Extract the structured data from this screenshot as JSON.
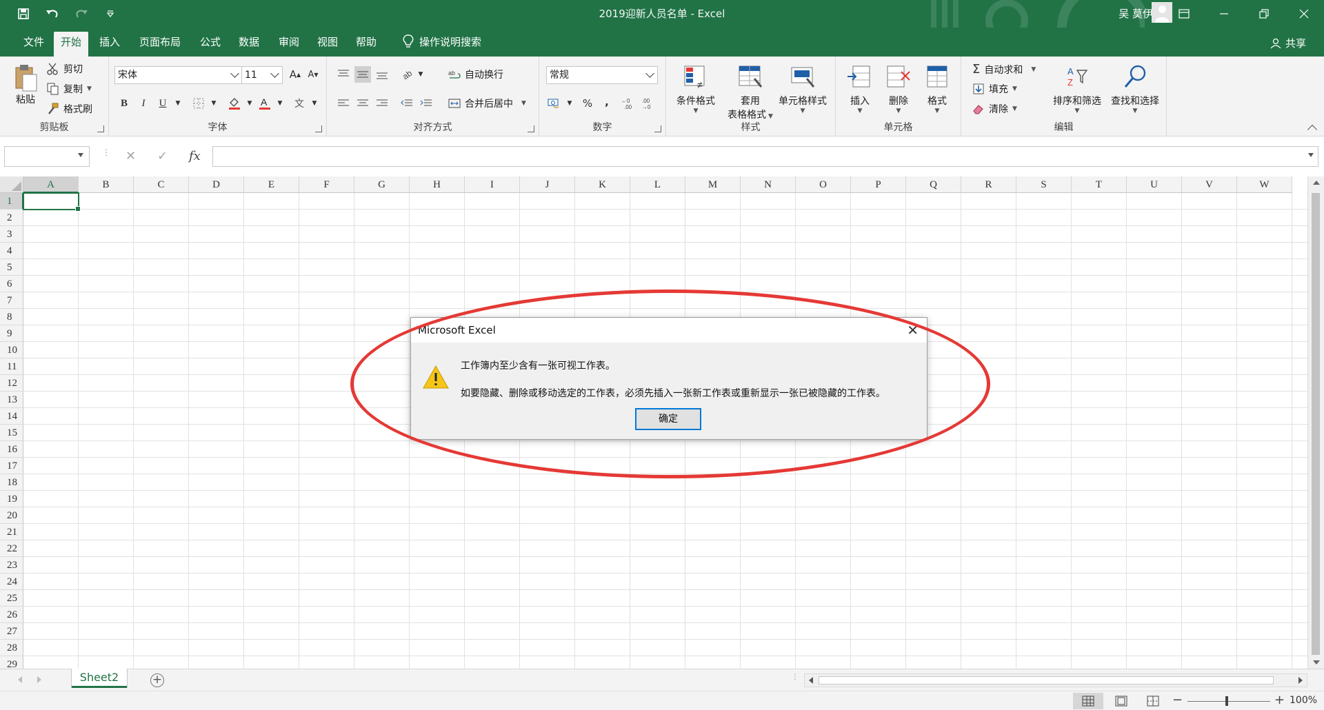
{
  "window": {
    "title": "2019迎新人员名单  -  Excel",
    "user": "吴 莫伊",
    "brand_color": "#217346"
  },
  "menu": {
    "tabs": [
      "文件",
      "开始",
      "插入",
      "页面布局",
      "公式",
      "数据",
      "审阅",
      "视图",
      "帮助"
    ],
    "active": "开始",
    "search_label": "操作说明搜索",
    "share_label": "共享"
  },
  "ribbon": {
    "clipboard": {
      "label": "剪贴板",
      "paste": "粘贴",
      "cut": "剪切",
      "copy": "复制",
      "format_painter": "格式刷"
    },
    "font": {
      "label": "字体",
      "font_name": "宋体",
      "font_size": "11",
      "bold": "B",
      "italic": "I",
      "underline": "U",
      "grow": "A",
      "shrink": "A",
      "phonetic": "文"
    },
    "alignment": {
      "label": "对齐方式",
      "wrap_text": "自动换行",
      "merge_center": "合并后居中"
    },
    "number": {
      "label": "数字",
      "format": "常规",
      "percent": "%",
      "comma": ","
    },
    "styles": {
      "label": "样式",
      "conditional": "条件格式",
      "table_line1": "套用",
      "table_line2": "表格格式",
      "cell_styles": "单元格样式"
    },
    "cells": {
      "label": "单元格",
      "insert": "插入",
      "delete": "删除",
      "format": "格式"
    },
    "editing": {
      "label": "编辑",
      "autosum": "自动求和",
      "fill": "填充",
      "clear": "清除",
      "sort_filter": "排序和筛选",
      "find_select": "查找和选择"
    }
  },
  "formula_bar": {
    "name_box": "",
    "fx": "fx",
    "content": ""
  },
  "grid": {
    "columns": [
      "A",
      "B",
      "C",
      "D",
      "E",
      "F",
      "G",
      "H",
      "I",
      "J",
      "K",
      "L",
      "M",
      "N",
      "O",
      "P",
      "Q",
      "R",
      "S",
      "T",
      "U",
      "V",
      "W"
    ],
    "rows": [
      "1",
      "2",
      "3",
      "4",
      "5",
      "6",
      "7",
      "8",
      "9",
      "10",
      "11",
      "12",
      "13",
      "14",
      "15",
      "16",
      "17",
      "18",
      "19",
      "20",
      "21",
      "22",
      "23",
      "24",
      "25",
      "26",
      "27",
      "28",
      "29"
    ],
    "active_cell": "A1"
  },
  "sheets": {
    "tabs": [
      "Sheet2"
    ],
    "active": "Sheet2"
  },
  "status": {
    "zoom": "100%"
  },
  "dialog": {
    "title": "Microsoft Excel",
    "message1": "工作簿内至少含有一张可视工作表。",
    "message2": "如要隐藏、删除或移动选定的工作表，必须先插入一张新工作表或重新显示一张已被隐藏的工作表。",
    "ok_label": "确定",
    "annotation_color": "#e53935"
  }
}
